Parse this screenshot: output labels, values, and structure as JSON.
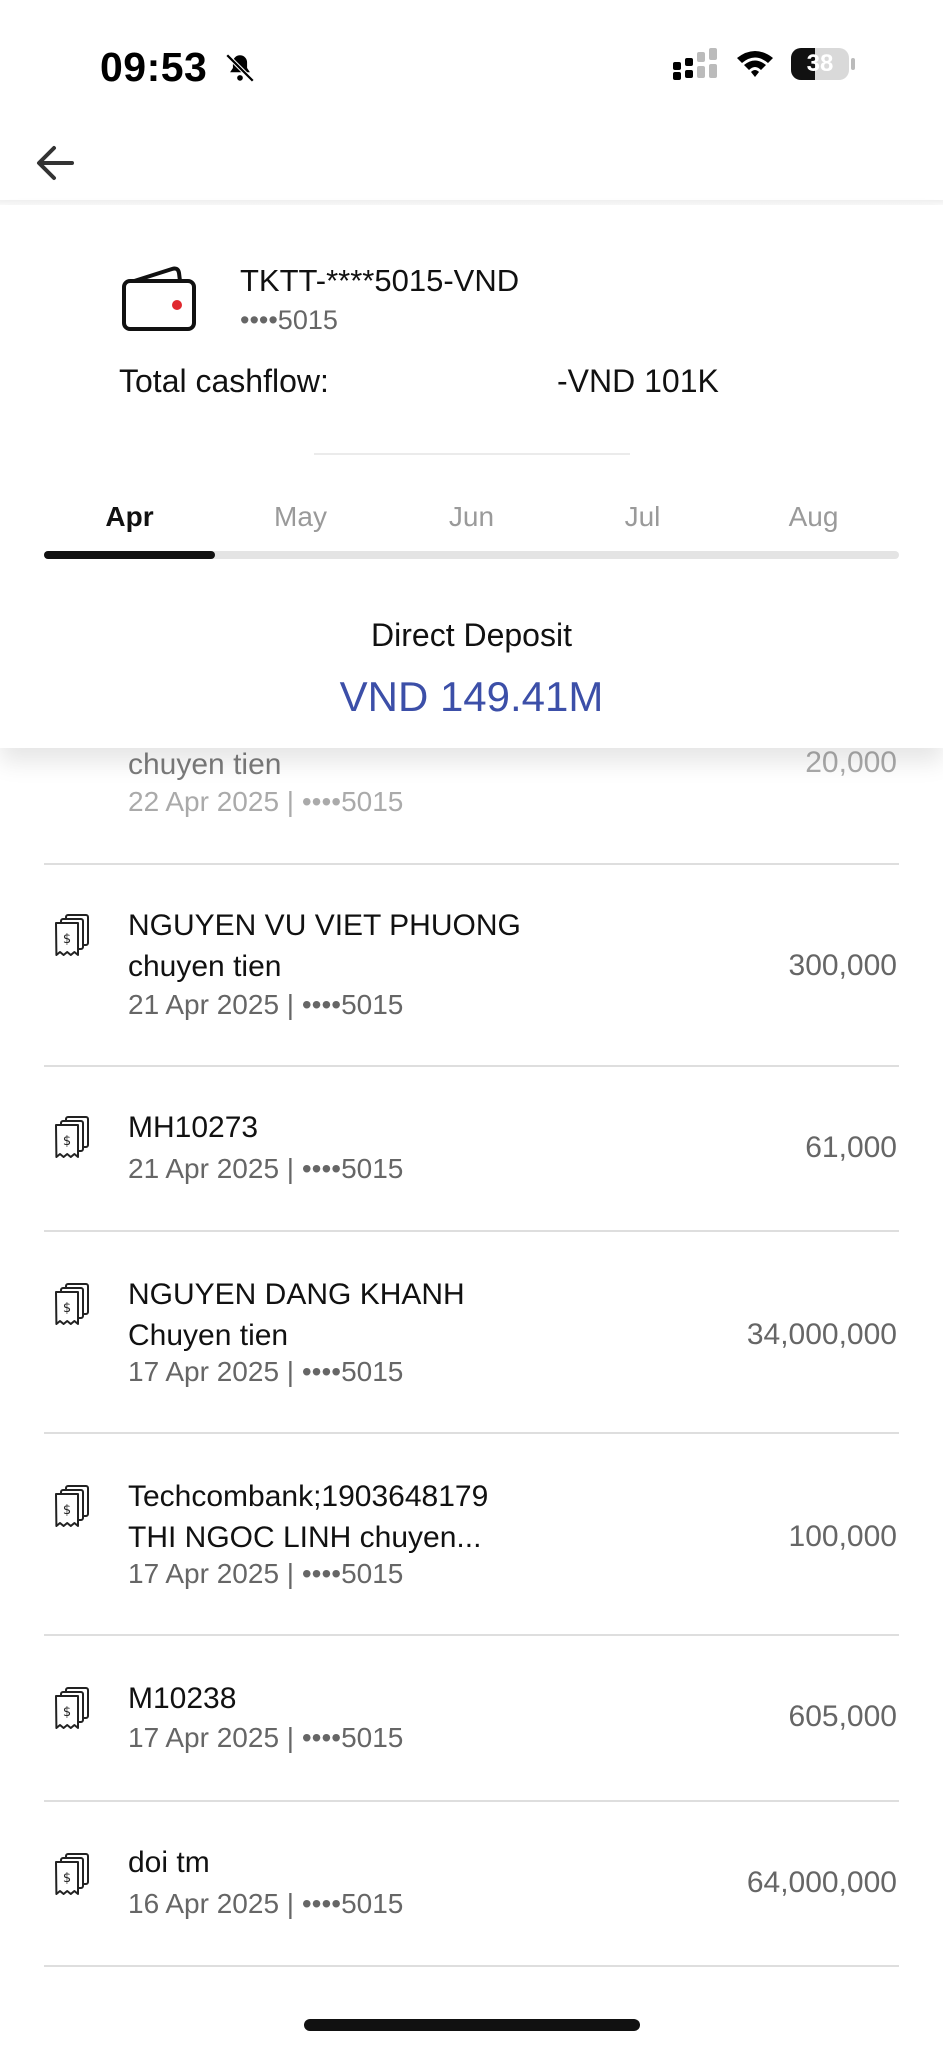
{
  "status_bar": {
    "time": "09:53",
    "battery": "38"
  },
  "account": {
    "name": "TKTT-****5015-VND",
    "masked_number": "••••5015"
  },
  "cashflow": {
    "label": "Total cashflow:",
    "value": "-VND 101K"
  },
  "months": [
    "Apr",
    "May",
    "Jun",
    "Jul",
    "Aug"
  ],
  "selected_month": "Apr",
  "summary": {
    "label": "Direct Deposit",
    "value": "VND 149.41M",
    "accent_color": "#3c4fa8"
  },
  "transactions": [
    {
      "title": "chuyen tien",
      "date": "22 Apr 2025 | ••••5015",
      "amount": "20,000"
    },
    {
      "title": "NGUYEN VU VIET PHUONG",
      "title2": "chuyen tien",
      "date": "21 Apr 2025 | ••••5015",
      "amount": "300,000"
    },
    {
      "title": "MH10273",
      "date": "21 Apr 2025 | ••••5015",
      "amount": "61,000"
    },
    {
      "title": "NGUYEN DANG KHANH",
      "title2": "Chuyen tien",
      "date": "17 Apr 2025 | ••••5015",
      "amount": "34,000,000"
    },
    {
      "title": "Techcombank;1903648179",
      "title2": "THI NGOC LINH chuyen...",
      "date": "17 Apr 2025 | ••••5015",
      "amount": "100,000"
    },
    {
      "title": "M10238",
      "date": "17 Apr 2025 | ••••5015",
      "amount": "605,000"
    },
    {
      "title": "doi tm",
      "date": "16 Apr 2025 | ••••5015",
      "amount": "64,000,000"
    }
  ]
}
